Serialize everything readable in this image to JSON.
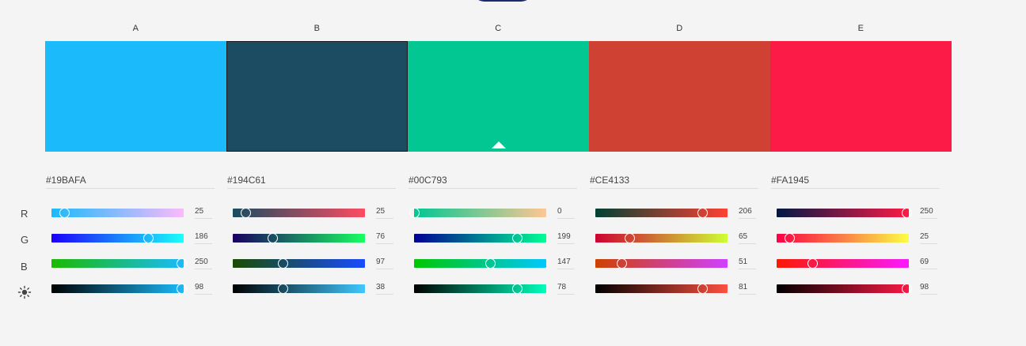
{
  "columns": [
    {
      "label": "A",
      "hex": "#19BAFA",
      "swatch_color": "#1bbafb",
      "selected": false,
      "sliders": {
        "r": {
          "value": "25",
          "fraction": 0.098,
          "gradient": [
            "#1bbafb",
            "#fbbafb"
          ]
        },
        "g": {
          "value": "186",
          "fraction": 0.729,
          "gradient": [
            "#1b00fb",
            "#1bfffb"
          ]
        },
        "b": {
          "value": "250",
          "fraction": 0.98,
          "gradient": [
            "#1bba00",
            "#1bbafb"
          ]
        },
        "brightness": {
          "value": "98",
          "fraction": 0.98,
          "gradient": [
            "#000000",
            "#1bbafb"
          ]
        }
      }
    },
    {
      "label": "B",
      "hex": "#194C61",
      "swatch_color": "#1b4c61",
      "selected": true,
      "sliders": {
        "r": {
          "value": "25",
          "fraction": 0.098,
          "gradient": [
            "#194c61",
            "#ff4c61"
          ]
        },
        "g": {
          "value": "76",
          "fraction": 0.298,
          "gradient": [
            "#190061",
            "#19ff61"
          ]
        },
        "b": {
          "value": "97",
          "fraction": 0.38,
          "gradient": [
            "#194c00",
            "#194cff"
          ]
        },
        "brightness": {
          "value": "38",
          "fraction": 0.38,
          "gradient": [
            "#000000",
            "#40c8ff"
          ]
        }
      }
    },
    {
      "label": "C",
      "hex": "#00C793",
      "swatch_color": "#02c793",
      "selected": false,
      "active": true,
      "sliders": {
        "r": {
          "value": "0",
          "fraction": 0.0,
          "gradient": [
            "#00c793",
            "#ffc793"
          ]
        },
        "g": {
          "value": "199",
          "fraction": 0.78,
          "gradient": [
            "#000093",
            "#00ff93"
          ]
        },
        "b": {
          "value": "147",
          "fraction": 0.576,
          "gradient": [
            "#00c700",
            "#00c7ff"
          ]
        },
        "brightness": {
          "value": "78",
          "fraction": 0.78,
          "gradient": [
            "#000000",
            "#00ffbc"
          ]
        }
      }
    },
    {
      "label": "D",
      "hex": "#CE4133",
      "swatch_color": "#ce4133",
      "selected": false,
      "sliders": {
        "r": {
          "value": "206",
          "fraction": 0.808,
          "gradient": [
            "#004133",
            "#ff4133"
          ]
        },
        "g": {
          "value": "65",
          "fraction": 0.255,
          "gradient": [
            "#ce0033",
            "#ceff33"
          ]
        },
        "b": {
          "value": "51",
          "fraction": 0.2,
          "gradient": [
            "#ce4100",
            "#ce41ff"
          ]
        },
        "brightness": {
          "value": "81",
          "fraction": 0.81,
          "gradient": [
            "#000000",
            "#fe5140"
          ]
        }
      }
    },
    {
      "label": "E",
      "hex": "#FA1945",
      "swatch_color": "#fc1b46",
      "selected": false,
      "sliders": {
        "r": {
          "value": "250",
          "fraction": 0.98,
          "gradient": [
            "#001945",
            "#ff1945"
          ]
        },
        "g": {
          "value": "25",
          "fraction": 0.098,
          "gradient": [
            "#fa0045",
            "#faff45"
          ]
        },
        "b": {
          "value": "69",
          "fraction": 0.27,
          "gradient": [
            "#fa1900",
            "#fa19ff"
          ]
        },
        "brightness": {
          "value": "98",
          "fraction": 0.98,
          "gradient": [
            "#000000",
            "#fa1945"
          ]
        }
      }
    }
  ],
  "row_labels": {
    "r": "R",
    "g": "G",
    "b": "B",
    "brightness_icon": "sun-icon"
  }
}
